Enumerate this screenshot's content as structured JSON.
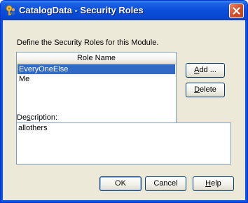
{
  "window": {
    "title": "CatalogData - Security Roles",
    "icon": "key-person-icon",
    "close_icon": "close-icon",
    "colors": {
      "titlebar": "#0a4fd8",
      "close": "#d6502c",
      "face": "#ece9d8",
      "selection": "#316ac5"
    }
  },
  "instructions": "Define the Security Roles for this Module.",
  "roles": {
    "header": "Role Name",
    "items": [
      {
        "label": "EveryOneElse",
        "selected": true
      },
      {
        "label": "Me",
        "selected": false
      }
    ]
  },
  "buttons": {
    "add": {
      "accel": "A",
      "rest": "dd ..."
    },
    "delete": {
      "accel": "D",
      "rest": "elete"
    },
    "ok": "OK",
    "cancel": "Cancel",
    "help": {
      "accel": "H",
      "rest": "elp"
    }
  },
  "description": {
    "label_pre": "De",
    "label_accel": "s",
    "label_post": "cription:",
    "value": "allothers"
  }
}
